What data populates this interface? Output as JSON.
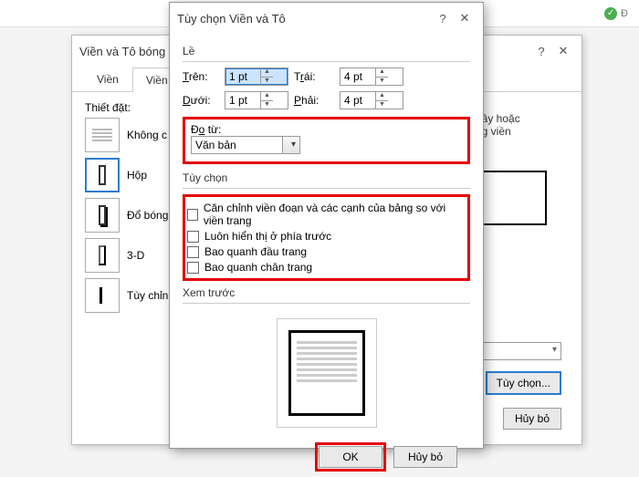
{
  "topbar": {
    "share": "Đ"
  },
  "bg": {
    "title": "Viền và Tô bóng",
    "tabs": {
      "border": "Viền",
      "page_border": "Viền Tr"
    },
    "section": "Thiết đặt:",
    "styles": {
      "none": "Không c",
      "box": "Hộp",
      "shadow": "Đổ bóng",
      "threeD": "3-D",
      "custom": "Tùy chỉn"
    },
    "right_hint": "dây hoặc\nng viền",
    "options_btn": "Tùy chọn...",
    "cancel_btn": "Hủy bỏ"
  },
  "fg": {
    "title": "Tùy chọn Viền và Tô",
    "margins_group": "Lề",
    "top_label": "Trên:",
    "bottom_label": "Dưới:",
    "left_label": "Trái:",
    "right_label": "Phải:",
    "top_val": "1 pt",
    "bottom_val": "1 pt",
    "left_val": "4 pt",
    "right_val": "4 pt",
    "measure_label": "Đo từ:",
    "measure_value": "Văn bản",
    "options_group": "Tùy chọn",
    "checks": {
      "c1": "Căn chỉnh viền đoạn và các cạnh của bảng so với viền trang",
      "c2": "Luôn hiển thị ở phía trước",
      "c3": "Bao quanh đầu trang",
      "c4": "Bao quanh chân trang"
    },
    "preview_group": "Xem trước",
    "ok": "OK",
    "cancel": "Hủy bỏ"
  }
}
